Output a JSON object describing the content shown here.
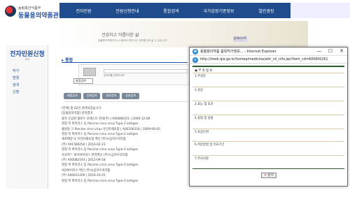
{
  "site": {
    "org": "농림축산식품부",
    "title": "동물용의약품관리시스템",
    "nav": [
      "전자민원",
      "민원신청안내",
      "통합검색",
      "국가검정기준정보",
      "열린광장"
    ],
    "left_panel_title": "전자민원신청",
    "left_panel_sub": "정보",
    "left_items": [
      "허가",
      "변경",
      "검색",
      "신청"
    ],
    "banner_text": "건강하고 아름다운 삶",
    "banner_sub": "동물용의약품관리시스템에서 원하시는 정보를 찾으실 수 있습니다.",
    "side_box": "검색리스트",
    "section_title": "▸ 통합",
    "search_dropdown": "통합검색",
    "search_hint": "검색어를 입력하세요",
    "tabs": [
      "제품검색",
      "업체검색",
      "원료검색",
      "성분검색"
    ],
    "results": [
      "[전체] 총 62건 검색되었습니다.",
      "",
      "[동물용의약품] 검색결과",
      "품목 신상원 폴린수 포레스트 현대(주) | A00068151 | 2009-12-08",
      "명칭 목 파이러스 등 Porcine circo virus Type-2 antigen",
      "출원일 고 Porcine circo virus 유전자재조합 | A00100334 | 2009-06-05",
      "명칭 목 파이러스 등 Porcine circo virus Type-2 antigen",
      "세포배양 모 유전자재조합 백신 (주)녹십자수의약품",
      "(주) A01580250 | 2016-02-23",
      "명칭 목 파이러스 등 Porcine circo virus Type-2 antigen",
      "프로백™ 써코바이러스 면역백신 (주)녹십자수의약품",
      "(주) A00082193 | 2012-09-18",
      "명칭 목 파이러스 등 Porcine circo virus Type-2 antigen",
      "써코바이러스 백신 (주)녹십자수의약품",
      "(주) A00011200 | 2016-10-25",
      "명칭 목 파이러스 등 Porcine circo virus Type-2 antigen"
    ]
  },
  "popup": {
    "title": "동물용의약품 품목허가정보... - Internet Explorer",
    "url": "http://medi.qia.go.kr/homep/medicine/attr_ctl_info.jsp?item_cd=A00600261",
    "header": "▣ 부 속 정 보",
    "fields": [
      "1.주성분",
      "2.성상",
      "3.효능 및 효과",
      "4.용법 및 용량",
      "5.포장단위",
      "6.저장방법 및 유효기간",
      "7.주의사항"
    ],
    "close_label": "닫기",
    "close_glyph": "✕",
    "window_buttons": {
      "minimize": "—",
      "maximize": "☐",
      "close": "✕"
    },
    "ie_glyph": "e"
  }
}
